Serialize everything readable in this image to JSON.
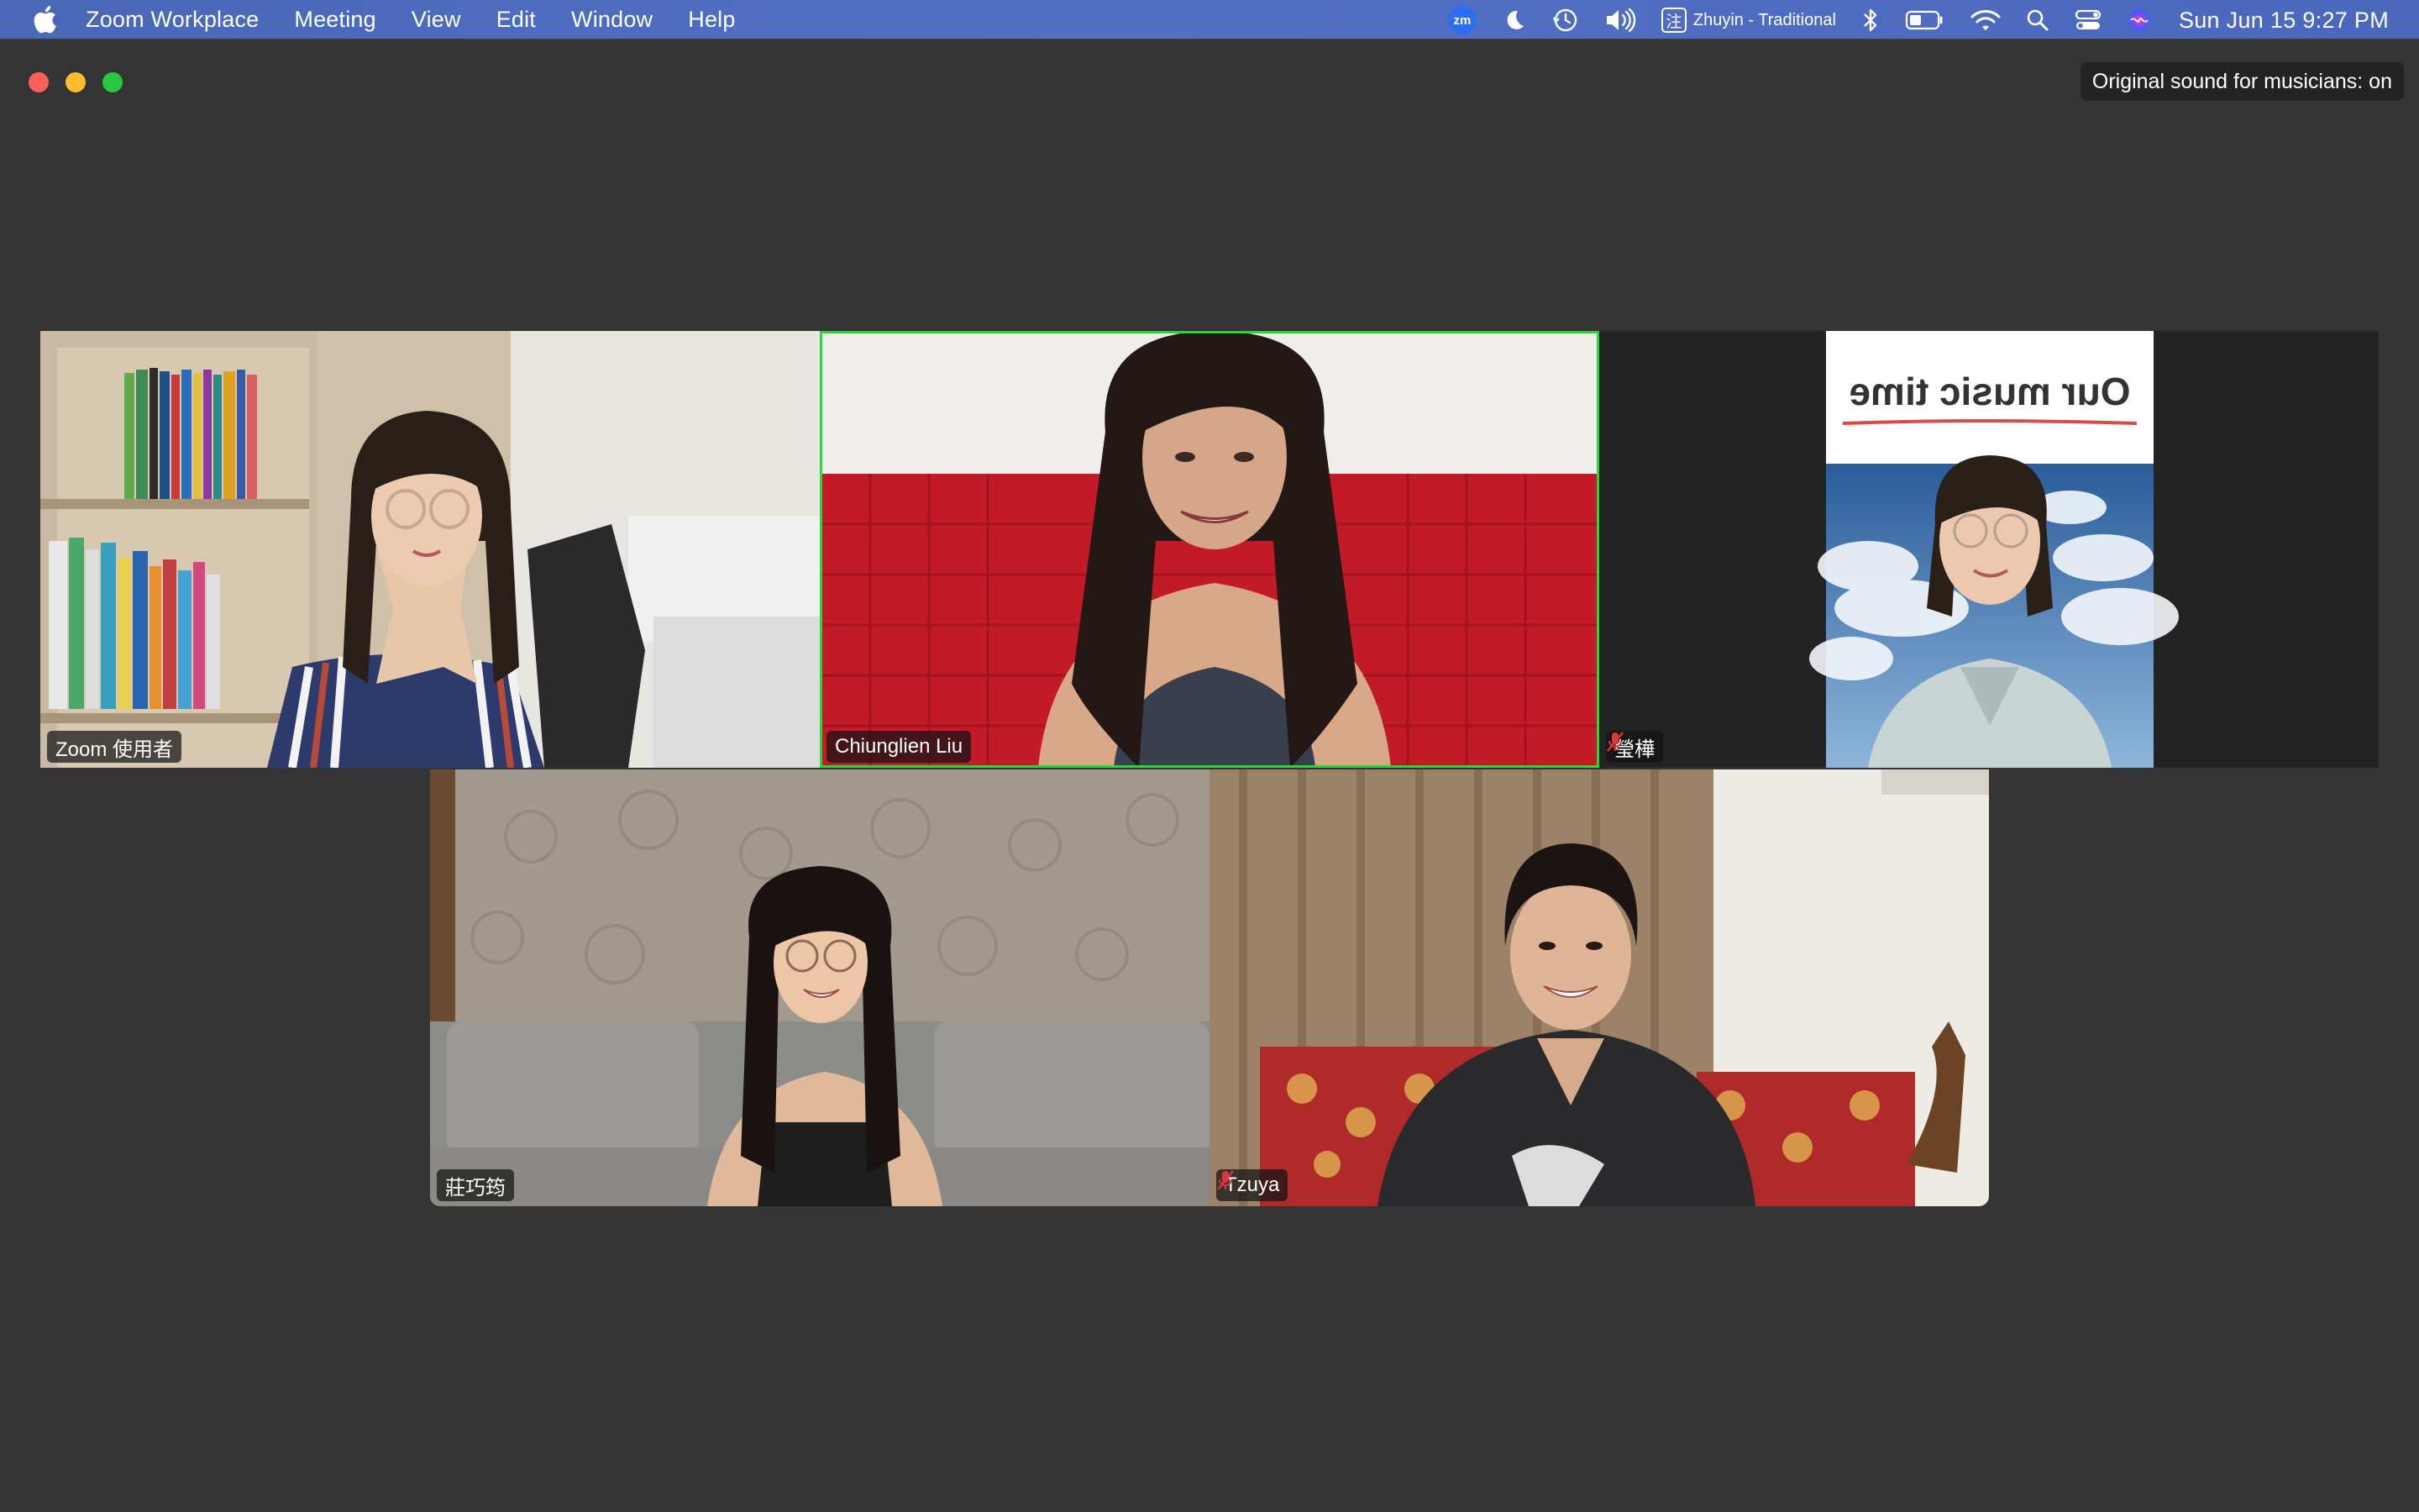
{
  "menubar": {
    "app_name": "Zoom Workplace",
    "items": [
      "Meeting",
      "View",
      "Edit",
      "Window",
      "Help"
    ],
    "tray": {
      "zoom_badge": "zm",
      "input_source_glyph": "注",
      "input_source_label": "Zhuyin - Traditional",
      "datetime": "Sun Jun 15  9:27 PM"
    },
    "icons": [
      "apple-icon",
      "zoom-icon",
      "moon-icon",
      "time-machine-icon",
      "volume-icon",
      "bluetooth-icon",
      "battery-icon",
      "wifi-icon",
      "search-icon",
      "control-center-icon",
      "siri-icon"
    ]
  },
  "window": {
    "original_sound_status": "Original sound for musicians: on"
  },
  "participants": [
    {
      "name": "Zoom 使用者",
      "muted": false,
      "active_speaker": false
    },
    {
      "name": "Chiunglien Liu",
      "muted": false,
      "active_speaker": true
    },
    {
      "name": "瑩樺",
      "muted": true,
      "active_speaker": false,
      "background_text": "Our music time"
    },
    {
      "name": "莊巧筠",
      "muted": false,
      "active_speaker": false
    },
    {
      "name": "Tzuya",
      "muted": true,
      "active_speaker": false
    }
  ],
  "colors": {
    "menubar": "#5270c4",
    "window_bg": "#333433",
    "tile_bg": "#232323",
    "active_speaker_border": "#2fd43d",
    "muted_icon": "#e0353b"
  }
}
